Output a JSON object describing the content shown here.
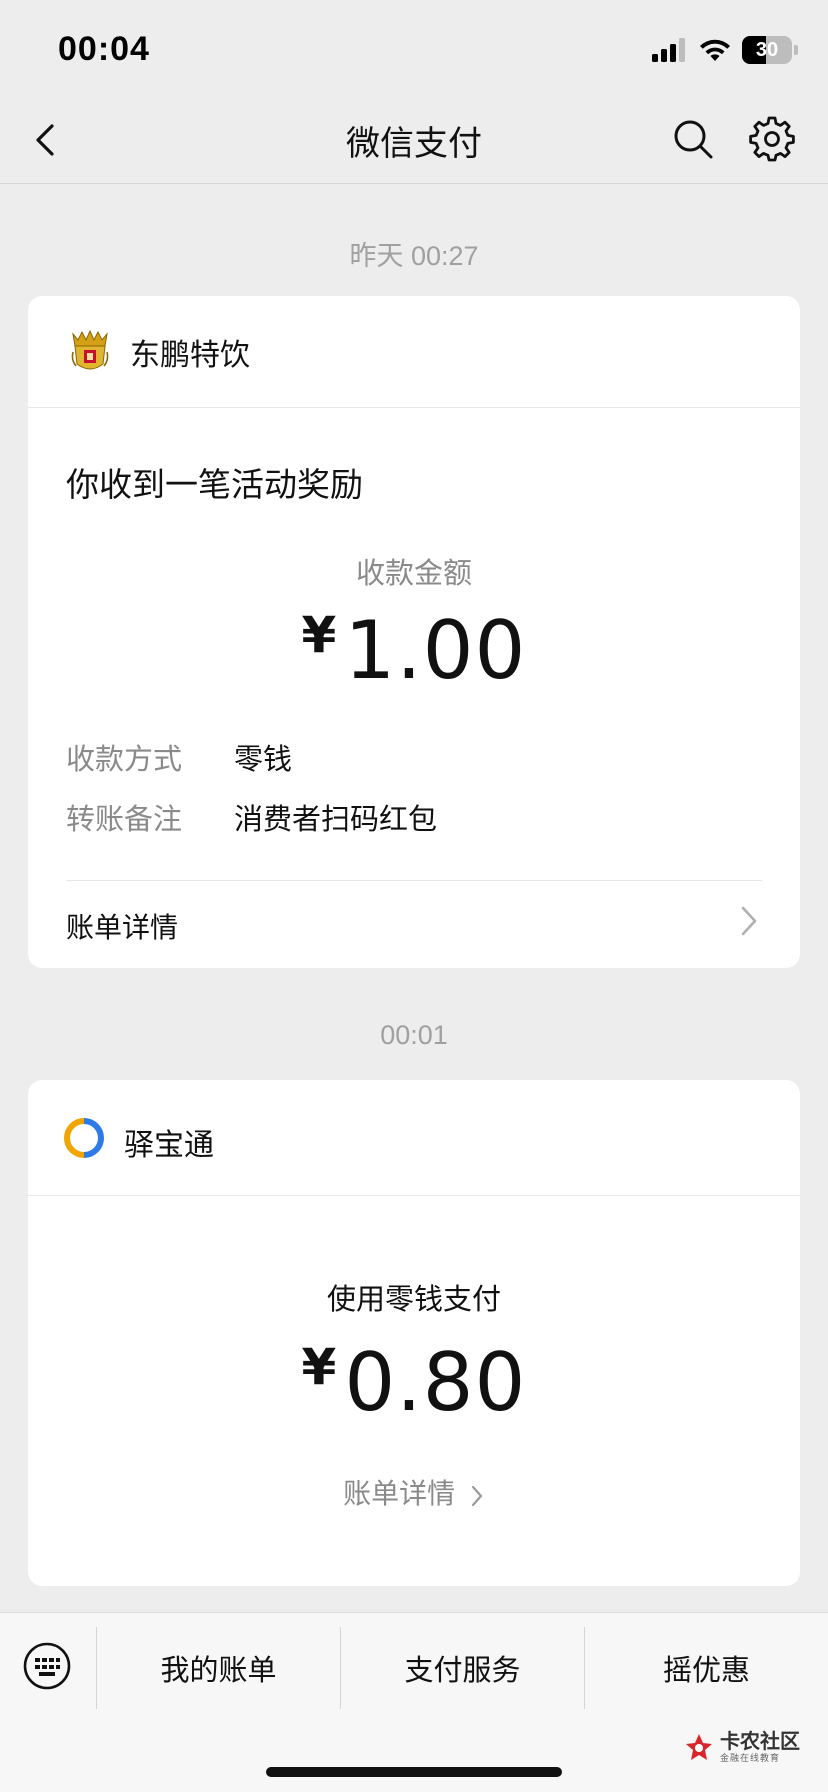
{
  "status_bar": {
    "time": "00:04",
    "battery": "30"
  },
  "nav": {
    "title": "微信支付"
  },
  "message1": {
    "timestamp": "昨天 00:27",
    "merchant": "东鹏特饮",
    "title": "你收到一笔活动奖励",
    "amount_label": "收款金额",
    "currency": "¥",
    "amount": "1.00",
    "rows": [
      {
        "label": "收款方式",
        "value": "零钱"
      },
      {
        "label": "转账备注",
        "value": "消费者扫码红包"
      }
    ],
    "detail_link": "账单详情"
  },
  "message2": {
    "timestamp": "00:01",
    "merchant": "驿宝通",
    "pay_label": "使用零钱支付",
    "currency": "¥",
    "amount": "0.80",
    "detail_link": "账单详情"
  },
  "bottom_tabs": [
    "我的账单",
    "支付服务",
    "摇优惠"
  ],
  "watermark": {
    "main": "卡农社区",
    "sub": "金融在线教育"
  },
  "colors": {
    "background": "#ededed",
    "card": "#ffffff",
    "muted_text": "#8a8a8a",
    "accent_logo_yellow": "#f0a500",
    "accent_logo_blue": "#2d7be6"
  }
}
